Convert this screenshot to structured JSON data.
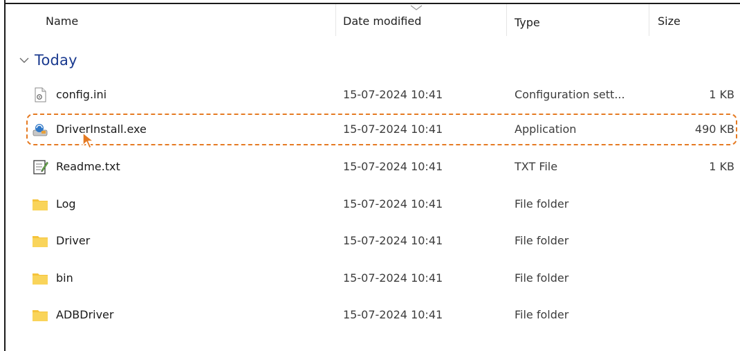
{
  "header": {
    "name": "Name",
    "date_modified": "Date modified",
    "type": "Type",
    "size": "Size"
  },
  "group": {
    "label": "Today",
    "chevron_icon": "chevron-down-icon"
  },
  "files": [
    {
      "name": "config.ini",
      "date": "15-07-2024 10:41",
      "type": "Configuration sett...",
      "size": "1 KB",
      "icon": "ini-file-icon"
    },
    {
      "name": "DriverInstall.exe",
      "date": "15-07-2024 10:41",
      "type": "Application",
      "size": "490 KB",
      "icon": "application-icon",
      "highlighted": true
    },
    {
      "name": "Readme.txt",
      "date": "15-07-2024 10:41",
      "type": "TXT File",
      "size": "1 KB",
      "icon": "text-file-icon"
    },
    {
      "name": "Log",
      "date": "15-07-2024 10:41",
      "type": "File folder",
      "size": "",
      "icon": "folder-icon"
    },
    {
      "name": "Driver",
      "date": "15-07-2024 10:41",
      "type": "File folder",
      "size": "",
      "icon": "folder-icon"
    },
    {
      "name": "bin",
      "date": "15-07-2024 10:41",
      "type": "File folder",
      "size": "",
      "icon": "folder-icon"
    },
    {
      "name": "ADBDriver",
      "date": "15-07-2024 10:41",
      "type": "File folder",
      "size": "",
      "icon": "folder-icon"
    }
  ],
  "colors": {
    "group_label": "#1a3a8f",
    "highlight_border": "#e57a22",
    "cursor": "#e57a22",
    "folder": "#f5c33b"
  }
}
